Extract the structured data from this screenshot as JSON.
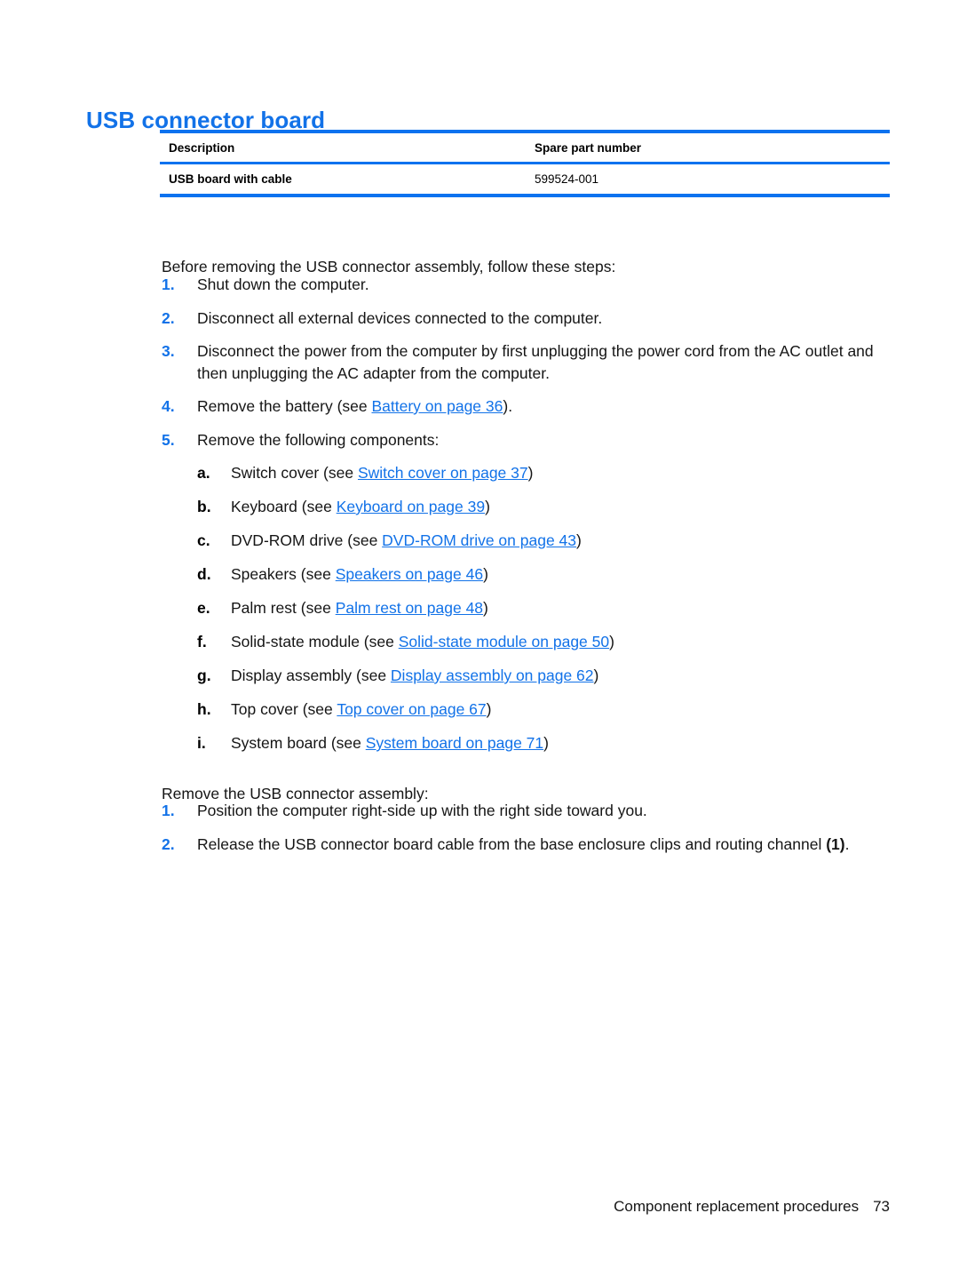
{
  "document": {
    "heading": "USB connector board",
    "accent_color": "#1272e8",
    "table_rule_color": "#0b72ef"
  },
  "parts_table": {
    "headers": [
      "Description",
      "Spare part number"
    ],
    "rows": [
      {
        "description": "USB board with cable",
        "spare_part_number": "599524-001"
      }
    ]
  },
  "intro": {
    "text": "Before removing the USB connector assembly, follow these steps:"
  },
  "prereq_steps": [
    {
      "marker": "1.",
      "text": "Shut down the computer."
    },
    {
      "marker": "2.",
      "text": "Disconnect all external devices connected to the computer."
    },
    {
      "marker": "3.",
      "text": "Disconnect the power from the computer by first unplugging the power cord from the AC outlet and then unplugging the AC adapter from the computer."
    },
    {
      "marker": "4.",
      "lead": "Remove the battery (see ",
      "link": "Battery on page 36",
      "tail": ")."
    },
    {
      "marker": "5.",
      "text": "Remove the following components:"
    }
  ],
  "components": [
    {
      "marker": "a.",
      "lead": "Switch cover (see ",
      "link": "Switch cover on page 37",
      "tail": ")"
    },
    {
      "marker": "b.",
      "lead": "Keyboard (see ",
      "link": "Keyboard on page 39",
      "tail": ")"
    },
    {
      "marker": "c.",
      "lead": "DVD-ROM drive (see ",
      "link": "DVD-ROM drive on page 43",
      "tail": ")"
    },
    {
      "marker": "d.",
      "lead": "Speakers (see ",
      "link": "Speakers on page 46",
      "tail": ")"
    },
    {
      "marker": "e.",
      "lead": "Palm rest (see ",
      "link": "Palm rest on page 48",
      "tail": ")"
    },
    {
      "marker": "f.",
      "lead": "Solid-state module (see ",
      "link": "Solid-state module on page 50",
      "tail": ")"
    },
    {
      "marker": "g.",
      "lead": "Display assembly (see ",
      "link": "Display assembly on page 62",
      "tail": ")"
    },
    {
      "marker": "h.",
      "lead": "Top cover (see ",
      "link": "Top cover on page 67",
      "tail": ")"
    },
    {
      "marker": "i.",
      "lead": "System board (see ",
      "link": "System board on page 71",
      "tail": ")"
    }
  ],
  "removal": {
    "intro": "Remove the USB connector assembly:",
    "steps": [
      {
        "marker": "1.",
        "text": "Position the computer right-side up with the right side toward you."
      },
      {
        "marker": "2.",
        "lead": "Release the USB connector board cable from the base enclosure clips and routing channel ",
        "callout": "(1)",
        "tail": "."
      }
    ]
  },
  "footer": {
    "label": "Component replacement procedures",
    "page_number": "73"
  }
}
